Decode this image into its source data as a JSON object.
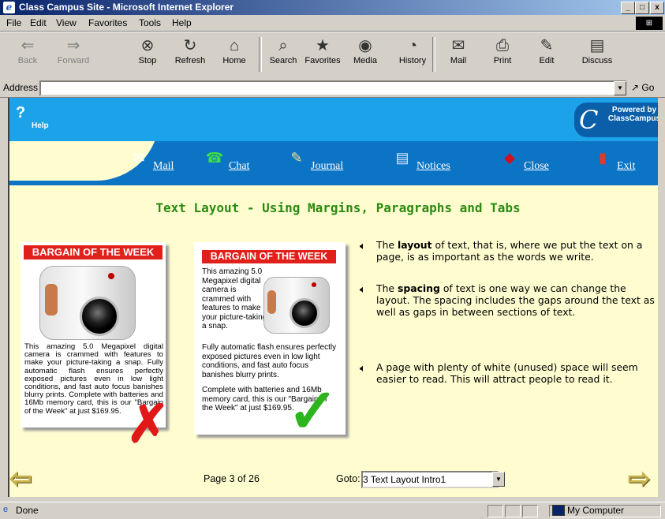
{
  "window": {
    "title": "Class Campus Site - Microsoft Internet Explorer",
    "controls": [
      "_",
      "□",
      "x"
    ]
  },
  "menubar": [
    "File",
    "Edit",
    "View",
    "Favorites",
    "Tools",
    "Help"
  ],
  "toolbar": [
    {
      "label": "Back",
      "icon": "back-arrow",
      "disabled": true
    },
    {
      "label": "Forward",
      "icon": "forward-arrow",
      "disabled": true
    },
    {
      "label": "Stop",
      "icon": "stop"
    },
    {
      "label": "Refresh",
      "icon": "refresh"
    },
    {
      "label": "Home",
      "icon": "home"
    },
    {
      "label": "Search",
      "icon": "search"
    },
    {
      "label": "Favorites",
      "icon": "favorites"
    },
    {
      "label": "Media",
      "icon": "media"
    },
    {
      "label": "History",
      "icon": "history"
    },
    {
      "label": "Mail",
      "icon": "mail"
    },
    {
      "label": "Print",
      "icon": "print"
    },
    {
      "label": "Edit",
      "icon": "edit"
    },
    {
      "label": "Discuss",
      "icon": "discuss"
    }
  ],
  "address": {
    "label": "Address",
    "value": "",
    "go": "Go"
  },
  "site": {
    "help": "Help",
    "logo": {
      "mark": "C",
      "text": "Powered by ClassCampus"
    },
    "nav": [
      {
        "label": "Mail",
        "icon": "mail-envelope"
      },
      {
        "label": "Chat",
        "icon": "chat-phone"
      },
      {
        "label": "Journal",
        "icon": "journal-notepad"
      },
      {
        "label": "Notices",
        "icon": "notices-board"
      },
      {
        "label": "Close",
        "icon": "close-book"
      },
      {
        "label": "Exit",
        "icon": "exit-door"
      }
    ]
  },
  "lesson": {
    "heading": "Text Layout - Using Margins, Paragraphs and Tabs",
    "bad_ad": {
      "title": "BARGAIN OF THE WEEK",
      "body": "This amazing 5.0 Megapixel digital camera is crammed with features to make your picture-taking a snap. Fully automatic flash ensures perfectly exposed pictures even in low light conditions, and fast auto focus banishes blurry prints. Complete with batteries and 16Mb memory card, this is our \"Bargain of the Week\" at just $169.95.",
      "mark": "✗"
    },
    "good_ad": {
      "title": "BARGAIN OF THE WEEK",
      "para1": "This amazing 5.0 Megapixel digital camera is crammed with features to make your picture-taking a snap.",
      "para2": "Fully automatic flash ensures perfectly exposed pictures even in low light conditions, and fast auto focus banishes blurry prints.",
      "para3": "Complete with batteries and 16Mb memory card, this is our \"Bargain of the Week\" at just $169.95.",
      "mark": "✓"
    },
    "bullets": [
      {
        "pre": "The ",
        "bold": "layout",
        "post": " of text, that is, where we put the text on a page, is as important as the words we write."
      },
      {
        "pre": "The ",
        "bold": "spacing",
        "post": " of text is one way we can change the layout. The spacing includes the gaps around the text as well as gaps in between sections of text."
      },
      {
        "pre": "",
        "bold": "",
        "post": "A page with plenty of white (unused) space will seem easier to read. This will attract people to read it."
      }
    ]
  },
  "pager": {
    "info": "Page 3 of 26",
    "goto_label": "Goto:",
    "goto_value": "3 Text Layout Intro1"
  },
  "status": {
    "text": "Done",
    "zone": "My Computer"
  },
  "colors": {
    "header": "#1ba2e8",
    "nav": "#0c74c4",
    "content_bg": "#fffdd0",
    "heading": "#2a8a10",
    "ad_banner": "#e1201b"
  }
}
